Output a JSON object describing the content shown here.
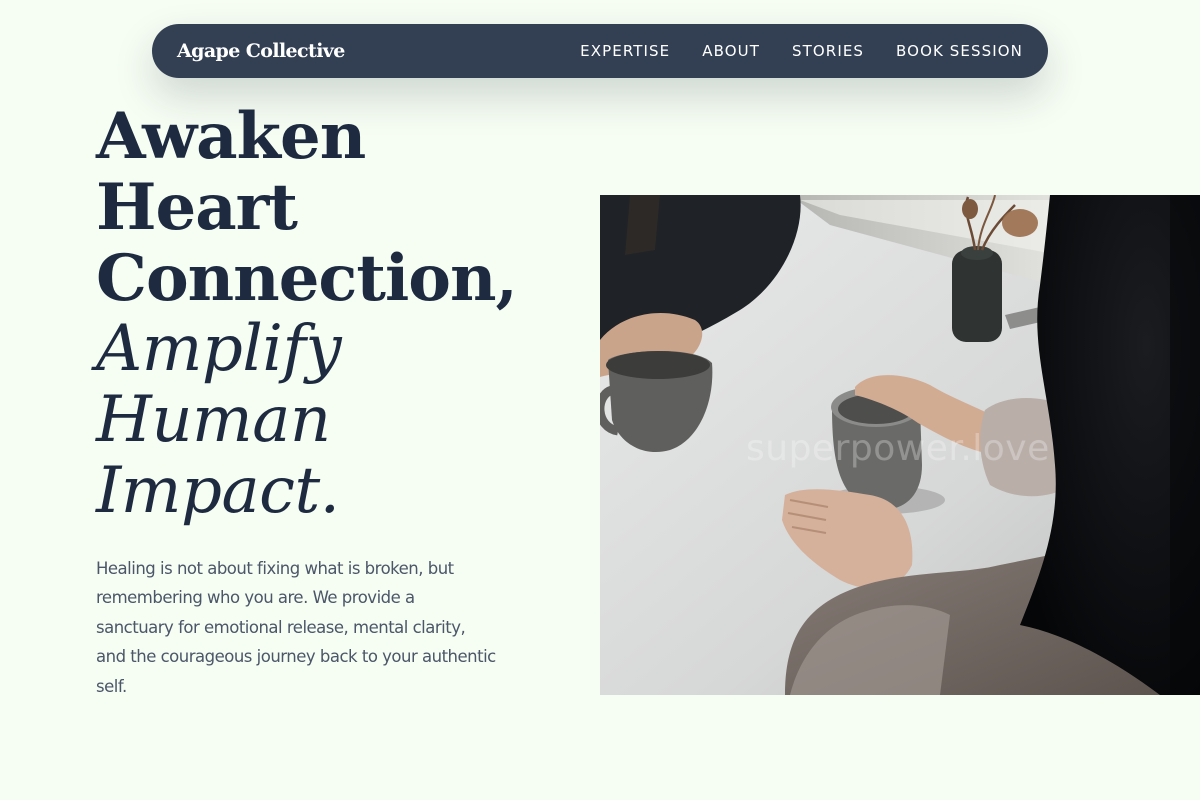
{
  "header": {
    "brand": "Agape Collective",
    "nav": [
      {
        "label": "EXPERTISE"
      },
      {
        "label": "ABOUT"
      },
      {
        "label": "STORIES"
      },
      {
        "label": "BOOK SESSION"
      }
    ]
  },
  "hero": {
    "title_lines": [
      "Awaken",
      "Heart",
      "Connection,"
    ],
    "title_italic_lines": [
      "Amplify",
      "Human",
      "Impact."
    ],
    "description": "Healing is not about fixing what is broken, but remembering who you are. We provide a sanctuary for emotional release, mental clarity, and the courageous journey back to your authentic self.",
    "image": {
      "watermark": "superpower.love"
    }
  },
  "colors": {
    "background": "#f6fdf3",
    "nav_background": "#334054",
    "title": "#1e2a40",
    "body_text": "#4b5668"
  }
}
